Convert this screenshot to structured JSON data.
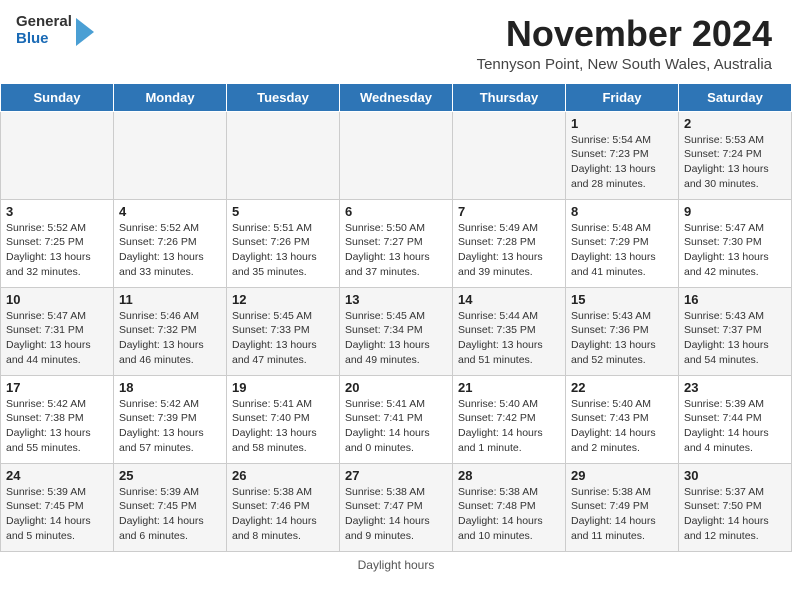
{
  "header": {
    "logo": {
      "general": "General",
      "blue": "Blue"
    },
    "title": "November 2024",
    "location": "Tennyson Point, New South Wales, Australia"
  },
  "days_of_week": [
    "Sunday",
    "Monday",
    "Tuesday",
    "Wednesday",
    "Thursday",
    "Friday",
    "Saturday"
  ],
  "weeks": [
    [
      {
        "day": "",
        "info": ""
      },
      {
        "day": "",
        "info": ""
      },
      {
        "day": "",
        "info": ""
      },
      {
        "day": "",
        "info": ""
      },
      {
        "day": "",
        "info": ""
      },
      {
        "day": "1",
        "info": "Sunrise: 5:54 AM\nSunset: 7:23 PM\nDaylight: 13 hours\nand 28 minutes."
      },
      {
        "day": "2",
        "info": "Sunrise: 5:53 AM\nSunset: 7:24 PM\nDaylight: 13 hours\nand 30 minutes."
      }
    ],
    [
      {
        "day": "3",
        "info": "Sunrise: 5:52 AM\nSunset: 7:25 PM\nDaylight: 13 hours\nand 32 minutes."
      },
      {
        "day": "4",
        "info": "Sunrise: 5:52 AM\nSunset: 7:26 PM\nDaylight: 13 hours\nand 33 minutes."
      },
      {
        "day": "5",
        "info": "Sunrise: 5:51 AM\nSunset: 7:26 PM\nDaylight: 13 hours\nand 35 minutes."
      },
      {
        "day": "6",
        "info": "Sunrise: 5:50 AM\nSunset: 7:27 PM\nDaylight: 13 hours\nand 37 minutes."
      },
      {
        "day": "7",
        "info": "Sunrise: 5:49 AM\nSunset: 7:28 PM\nDaylight: 13 hours\nand 39 minutes."
      },
      {
        "day": "8",
        "info": "Sunrise: 5:48 AM\nSunset: 7:29 PM\nDaylight: 13 hours\nand 41 minutes."
      },
      {
        "day": "9",
        "info": "Sunrise: 5:47 AM\nSunset: 7:30 PM\nDaylight: 13 hours\nand 42 minutes."
      }
    ],
    [
      {
        "day": "10",
        "info": "Sunrise: 5:47 AM\nSunset: 7:31 PM\nDaylight: 13 hours\nand 44 minutes."
      },
      {
        "day": "11",
        "info": "Sunrise: 5:46 AM\nSunset: 7:32 PM\nDaylight: 13 hours\nand 46 minutes."
      },
      {
        "day": "12",
        "info": "Sunrise: 5:45 AM\nSunset: 7:33 PM\nDaylight: 13 hours\nand 47 minutes."
      },
      {
        "day": "13",
        "info": "Sunrise: 5:45 AM\nSunset: 7:34 PM\nDaylight: 13 hours\nand 49 minutes."
      },
      {
        "day": "14",
        "info": "Sunrise: 5:44 AM\nSunset: 7:35 PM\nDaylight: 13 hours\nand 51 minutes."
      },
      {
        "day": "15",
        "info": "Sunrise: 5:43 AM\nSunset: 7:36 PM\nDaylight: 13 hours\nand 52 minutes."
      },
      {
        "day": "16",
        "info": "Sunrise: 5:43 AM\nSunset: 7:37 PM\nDaylight: 13 hours\nand 54 minutes."
      }
    ],
    [
      {
        "day": "17",
        "info": "Sunrise: 5:42 AM\nSunset: 7:38 PM\nDaylight: 13 hours\nand 55 minutes."
      },
      {
        "day": "18",
        "info": "Sunrise: 5:42 AM\nSunset: 7:39 PM\nDaylight: 13 hours\nand 57 minutes."
      },
      {
        "day": "19",
        "info": "Sunrise: 5:41 AM\nSunset: 7:40 PM\nDaylight: 13 hours\nand 58 minutes."
      },
      {
        "day": "20",
        "info": "Sunrise: 5:41 AM\nSunset: 7:41 PM\nDaylight: 14 hours\nand 0 minutes."
      },
      {
        "day": "21",
        "info": "Sunrise: 5:40 AM\nSunset: 7:42 PM\nDaylight: 14 hours\nand 1 minute."
      },
      {
        "day": "22",
        "info": "Sunrise: 5:40 AM\nSunset: 7:43 PM\nDaylight: 14 hours\nand 2 minutes."
      },
      {
        "day": "23",
        "info": "Sunrise: 5:39 AM\nSunset: 7:44 PM\nDaylight: 14 hours\nand 4 minutes."
      }
    ],
    [
      {
        "day": "24",
        "info": "Sunrise: 5:39 AM\nSunset: 7:45 PM\nDaylight: 14 hours\nand 5 minutes."
      },
      {
        "day": "25",
        "info": "Sunrise: 5:39 AM\nSunset: 7:45 PM\nDaylight: 14 hours\nand 6 minutes."
      },
      {
        "day": "26",
        "info": "Sunrise: 5:38 AM\nSunset: 7:46 PM\nDaylight: 14 hours\nand 8 minutes."
      },
      {
        "day": "27",
        "info": "Sunrise: 5:38 AM\nSunset: 7:47 PM\nDaylight: 14 hours\nand 9 minutes."
      },
      {
        "day": "28",
        "info": "Sunrise: 5:38 AM\nSunset: 7:48 PM\nDaylight: 14 hours\nand 10 minutes."
      },
      {
        "day": "29",
        "info": "Sunrise: 5:38 AM\nSunset: 7:49 PM\nDaylight: 14 hours\nand 11 minutes."
      },
      {
        "day": "30",
        "info": "Sunrise: 5:37 AM\nSunset: 7:50 PM\nDaylight: 14 hours\nand 12 minutes."
      }
    ]
  ],
  "footer": {
    "daylight_hours_label": "Daylight hours"
  }
}
